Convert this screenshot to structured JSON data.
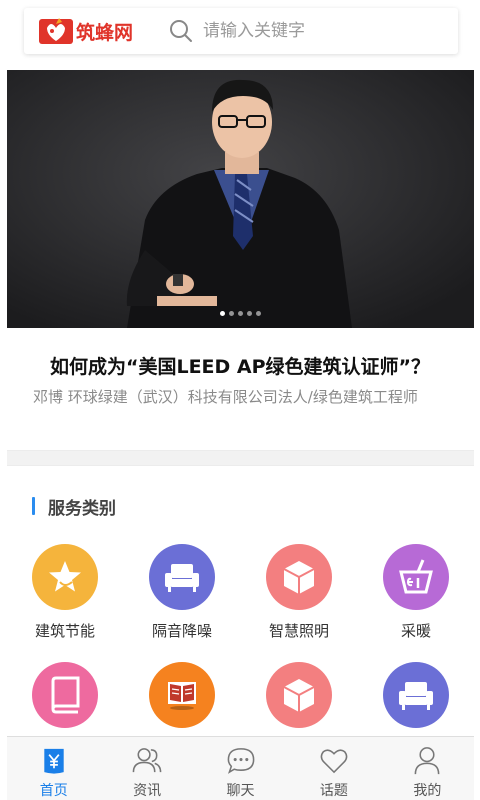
{
  "header": {
    "logo_text": "筑蜂网",
    "search_placeholder": "请输入关键字"
  },
  "banner": {
    "slide_count": 5,
    "active_slide": 1
  },
  "article": {
    "title": "如何成为“美国LEED AP绿色建筑认证师”？",
    "subtitle": "邓博 环球绿建（武汉）科技有限公司法人/绿色建筑工程师"
  },
  "section": {
    "title": "服务类别"
  },
  "services": [
    {
      "label": "建筑节能",
      "icon": "star-icon",
      "color": "#f5b43c"
    },
    {
      "label": "隔音降噪",
      "icon": "sofa-icon",
      "color": "#6b6fd6"
    },
    {
      "label": "智慧照明",
      "icon": "cube-icon",
      "color": "#f37f80"
    },
    {
      "label": "采暖",
      "icon": "drink-icon",
      "color": "#b76ad6"
    },
    {
      "label": "",
      "icon": "book-icon",
      "color": "#ee6a9f"
    },
    {
      "label": "",
      "icon": "open-book-icon",
      "color": "#f5821f"
    },
    {
      "label": "",
      "icon": "cube-icon",
      "color": "#f37f80"
    },
    {
      "label": "",
      "icon": "sofa-icon",
      "color": "#6b6fd6"
    }
  ],
  "tabs": [
    {
      "label": "首页",
      "icon": "home-yen-icon",
      "active": true
    },
    {
      "label": "资讯",
      "icon": "users-icon",
      "active": false
    },
    {
      "label": "聊天",
      "icon": "chat-icon",
      "active": false
    },
    {
      "label": "话题",
      "icon": "heart-icon",
      "active": false
    },
    {
      "label": "我的",
      "icon": "person-icon",
      "active": false
    }
  ],
  "colors": {
    "accent": "#1a7fe8",
    "brand": "#e0342a",
    "section_bar": "#2a8cef"
  }
}
